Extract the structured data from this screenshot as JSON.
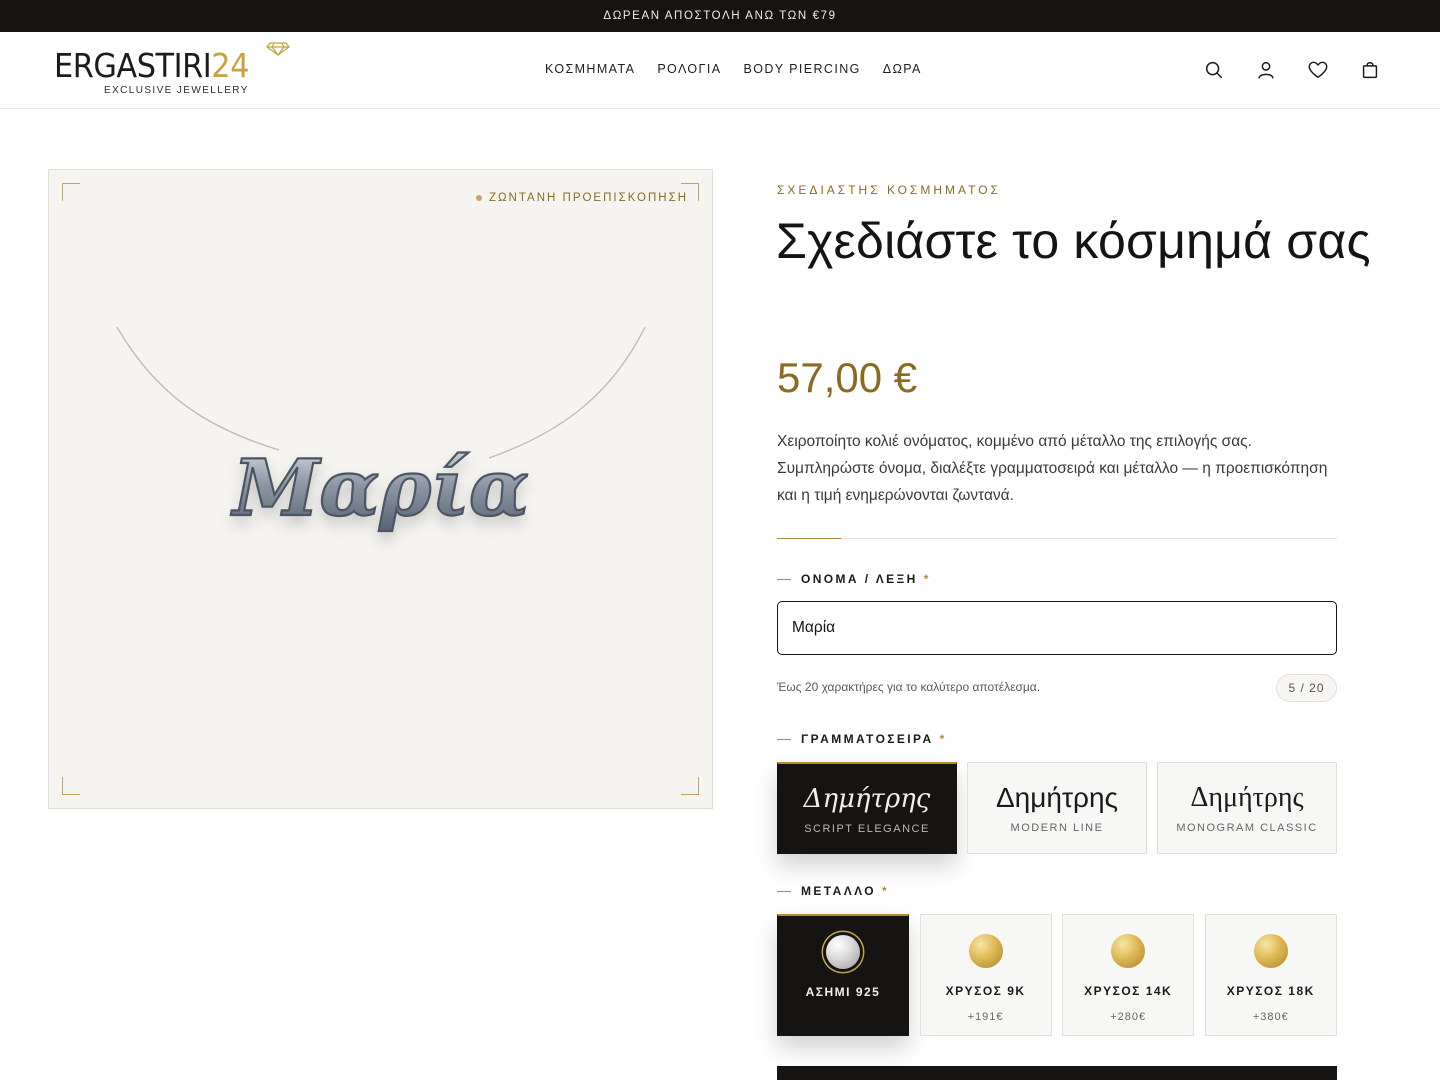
{
  "announcement": "ΔΩΡΕΑΝ ΑΠΟΣΤΟΛΗ ΑΝΩ ΤΩΝ €79",
  "brand": {
    "name": "ERGASTIRI",
    "number": "24",
    "tagline": "EXCLUSIVE JEWELLERY",
    "accent_color": "#c6a240"
  },
  "nav": {
    "items": [
      {
        "label": "ΚΟΣΜΗΜΑΤΑ"
      },
      {
        "label": "ΡΟΛΟΓΙΑ"
      },
      {
        "label": "BODY PIERCING"
      },
      {
        "label": "ΔΩΡΑ"
      }
    ]
  },
  "header_icons": [
    "search-icon",
    "account-icon",
    "wishlist-heart-icon",
    "shopping-bag-icon"
  ],
  "preview": {
    "badge": "ΖΩΝΤΑΝΗ ΠΡΟΕΠΙΣΚΟΠΗΣΗ",
    "pendant_text": "Μαρία",
    "metal_color": "#a8b2bd"
  },
  "product": {
    "eyebrow": "ΣΧΕΔΙΑΣΤΗΣ ΚΟΣΜΗΜΑΤΟΣ",
    "title": "Σχεδιάστε το κόσμημά σας",
    "price": "57,00 €",
    "description": "Χειροποίητο κολιέ ονόματος, κομμένο από μέταλλο της επιλογής σας. Συμπληρώστε όνομα, διαλέξτε γραμματοσειρά και μέταλλο — η προεπισκόπηση και η τιμή ενημερώνονται ζωντανά.",
    "price_color": "#8a6a22"
  },
  "name_field": {
    "label": "ΟΝΟΜΑ / ΛΕΞΗ",
    "required_mark": "*",
    "value": "Μαρία",
    "hint": "Έως 20 χαρακτήρες για το καλύτερο αποτέλεσμα.",
    "counter": "5 / 20"
  },
  "font_field": {
    "label": "ΓΡΑΜΜΑΤΟΣΕΙΡΑ",
    "required_mark": "*",
    "options": [
      {
        "sample": "Δημήτρης",
        "name": "SCRIPT ELEGANCE",
        "selected": true
      },
      {
        "sample": "Δημήτρης",
        "name": "MODERN LINE",
        "selected": false
      },
      {
        "sample": "Δημήτρης",
        "name": "MONOGRAM CLASSIC",
        "selected": false
      }
    ]
  },
  "metal_field": {
    "label": "ΜΕΤΑΛΛΟ",
    "required_mark": "*",
    "options": [
      {
        "name": "ΑΣΗΜΙ 925",
        "price": "",
        "selected": true
      },
      {
        "name": "ΧΡΥΣΟΣ 9K",
        "price": "+191€",
        "selected": false
      },
      {
        "name": "ΧΡΥΣΟΣ 14K",
        "price": "+280€",
        "selected": false
      },
      {
        "name": "ΧΡΥΣΟΣ 18K",
        "price": "+380€",
        "selected": false
      }
    ]
  }
}
